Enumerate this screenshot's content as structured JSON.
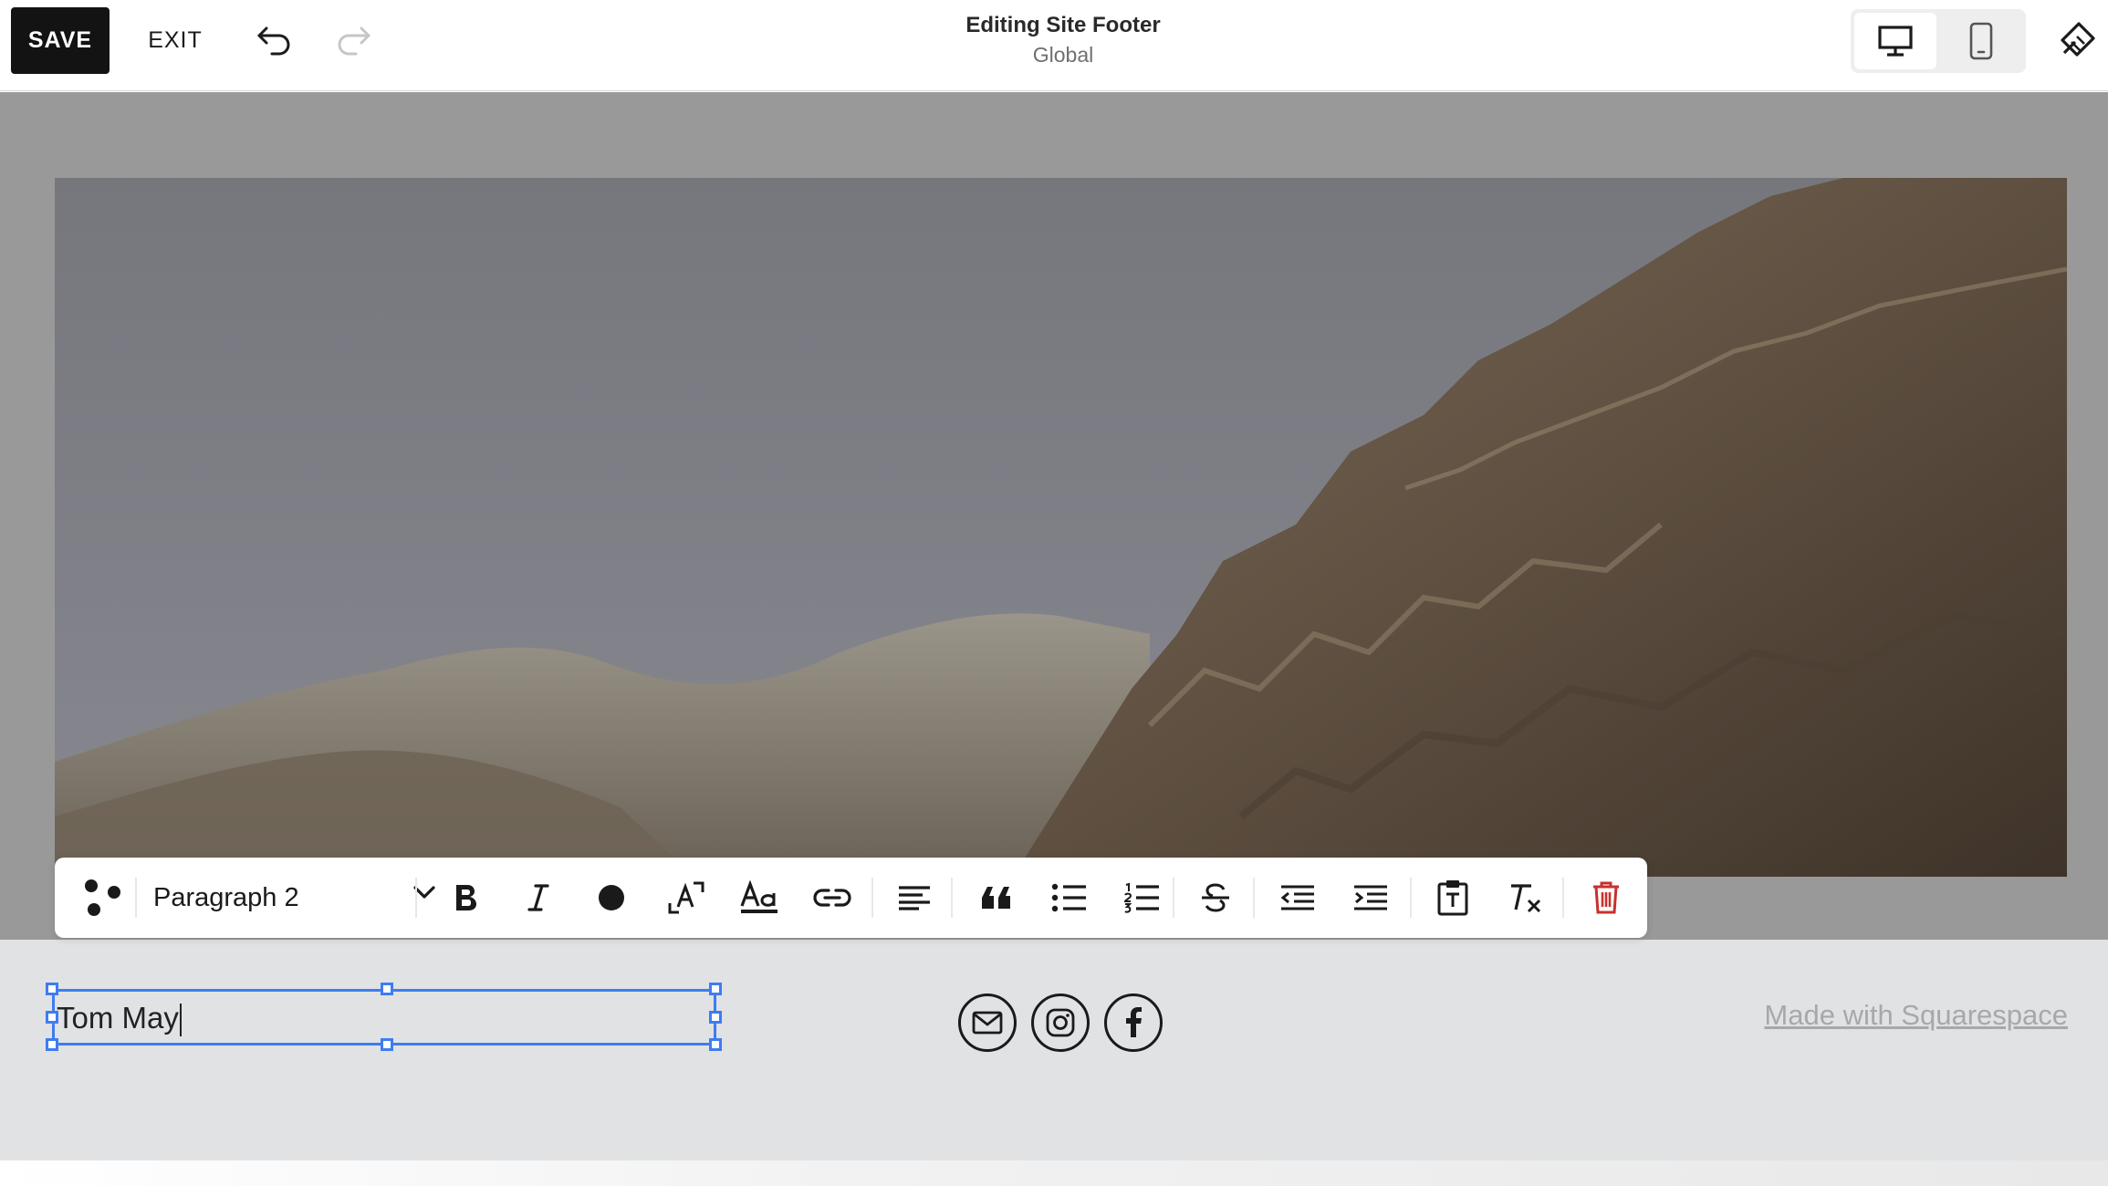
{
  "topbar": {
    "save_label": "SAVE",
    "exit_label": "EXIT",
    "title": "Editing Site Footer",
    "subtitle": "Global",
    "active_device": "desktop"
  },
  "canvas": {
    "slideshow": {
      "slide_count": 4,
      "active_slide": 4
    }
  },
  "toolbar": {
    "paragraph_style": "Paragraph 2",
    "buttons": [
      "block-menu",
      "bold",
      "italic",
      "text-color",
      "text-size",
      "typography",
      "link",
      "align-left",
      "blockquote",
      "bulleted-list",
      "numbered-list",
      "strikethrough",
      "outdent",
      "indent",
      "paste-as-plain-text",
      "clear-formatting",
      "delete"
    ]
  },
  "footer": {
    "text_block_value": "Tom May",
    "social_icons": [
      "email",
      "instagram",
      "facebook"
    ],
    "made_with": "Made with Squarespace"
  },
  "colors": {
    "selection": "#3e7cf1",
    "save_bg": "#131313",
    "delete": "#c8312d",
    "footer_bg": "#e1e2e4",
    "canvas_bg": "#999999"
  }
}
